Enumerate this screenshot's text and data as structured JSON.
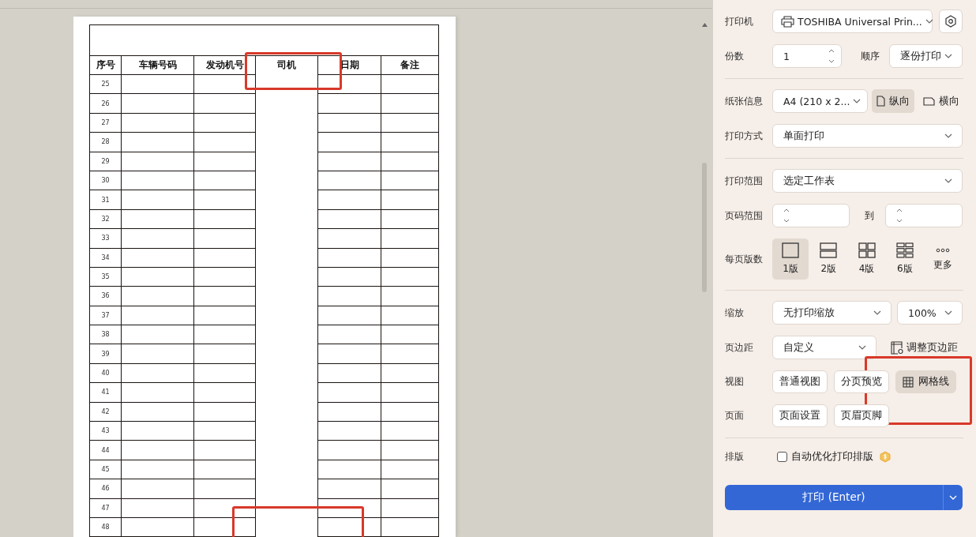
{
  "preview": {
    "columns": [
      {
        "label": "序号",
        "merged_below": false
      },
      {
        "label": "车辆号码",
        "merged_below": false
      },
      {
        "label": "发动机号",
        "merged_below": false
      },
      {
        "label": "司机",
        "merged_below": true
      },
      {
        "label": "日期",
        "merged_below": false
      },
      {
        "label": "备注",
        "merged_below": false
      }
    ],
    "row_numbers": [
      "25",
      "26",
      "27",
      "28",
      "29",
      "30",
      "31",
      "32",
      "33",
      "34",
      "35",
      "36",
      "37",
      "38",
      "39",
      "40",
      "41",
      "42",
      "43",
      "44",
      "45",
      "46",
      "47",
      "48"
    ]
  },
  "panel": {
    "printer": {
      "label": "打印机",
      "value": "TOSHIBA Universal Prin..."
    },
    "copies": {
      "label": "份数",
      "value": "1"
    },
    "order": {
      "label": "顺序",
      "value": "逐份打印"
    },
    "paper": {
      "label": "纸张信息",
      "value": "A4 (210 x 2...",
      "orientations": [
        {
          "label": "纵向",
          "kind": "portrait",
          "selected": true
        },
        {
          "label": "横向",
          "kind": "landscape",
          "selected": false
        }
      ]
    },
    "print_mode": {
      "label": "打印方式",
      "value": "单面打印"
    },
    "print_range": {
      "label": "打印范围",
      "value": "选定工作表"
    },
    "page_range": {
      "label": "页码范围",
      "to_label": "到"
    },
    "pages_per_sheet": {
      "label": "每页版数",
      "options": [
        {
          "label": "1版",
          "kind": "one",
          "selected": true
        },
        {
          "label": "2版",
          "kind": "two",
          "selected": false
        },
        {
          "label": "4版",
          "kind": "four",
          "selected": false
        },
        {
          "label": "6版",
          "kind": "six",
          "selected": false
        },
        {
          "label": "更多",
          "kind": "more",
          "selected": false
        }
      ]
    },
    "scaling": {
      "label": "缩放",
      "value": "无打印缩放",
      "percent": "100%"
    },
    "margins": {
      "label": "页边距",
      "value": "自定义",
      "adjust_label": "调整页边距"
    },
    "view": {
      "label": "视图",
      "options": [
        {
          "label": "普通视图",
          "kind": "plain",
          "selected": false
        },
        {
          "label": "分页预览",
          "kind": "plain",
          "selected": false
        },
        {
          "label": "网格线",
          "kind": "gridlines",
          "selected": true
        }
      ]
    },
    "page": {
      "label": "页面",
      "buttons": [
        "页面设置",
        "页眉页脚"
      ]
    },
    "layout": {
      "label": "排版",
      "checkbox": {
        "label": "自动优化打印排版",
        "checked": false
      }
    },
    "print_button": {
      "label": "打印 (Enter)"
    }
  }
}
